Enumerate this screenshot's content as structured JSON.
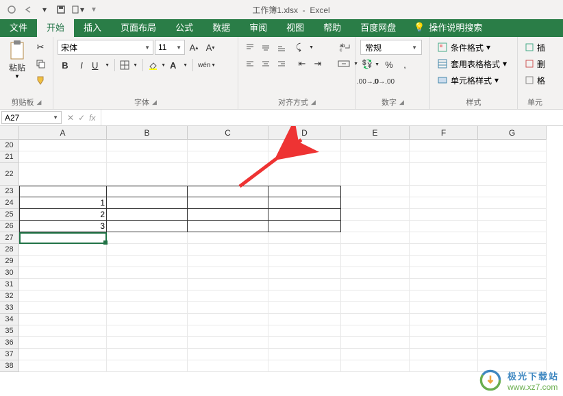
{
  "title": {
    "filename": "工作簿1.xlsx",
    "appname": "Excel"
  },
  "tabs": [
    "文件",
    "开始",
    "插入",
    "页面布局",
    "公式",
    "数据",
    "审阅",
    "视图",
    "帮助",
    "百度网盘"
  ],
  "active_tab": "开始",
  "tell_me": "操作说明搜索",
  "ribbon": {
    "clipboard": {
      "paste": "粘贴",
      "label": "剪贴板"
    },
    "font": {
      "name": "宋体",
      "size": "11",
      "label": "字体",
      "bold": "B",
      "italic": "I",
      "underline": "U",
      "wen": "wén"
    },
    "alignment": {
      "label": "对齐方式"
    },
    "number": {
      "format": "常规",
      "label": "数字"
    },
    "styles": {
      "cond": "条件格式",
      "table": "套用表格格式",
      "cell": "单元格样式",
      "label": "样式"
    },
    "cells": {
      "delete": "删",
      "label": "单元"
    }
  },
  "formula_bar": {
    "name_box": "A27",
    "fx": "fx"
  },
  "grid": {
    "col_widths": {
      "A": 128,
      "B": 118,
      "C": 118,
      "D": 106,
      "E": 100,
      "F": 100,
      "G": 100
    },
    "cols": [
      "A",
      "B",
      "C",
      "D",
      "E",
      "F",
      "G"
    ],
    "row_start": 20,
    "row_end": 38,
    "row_heights": {
      "default": 17,
      "22": 33
    },
    "cells": {
      "A24": "1",
      "A25": "2",
      "A26": "3"
    },
    "bordered_range": {
      "r1": 23,
      "r2": 26,
      "c1": "A",
      "c2": "D"
    },
    "active": "A27"
  },
  "watermark": {
    "cn": "极光下载站",
    "url": "www.xz7.com"
  }
}
